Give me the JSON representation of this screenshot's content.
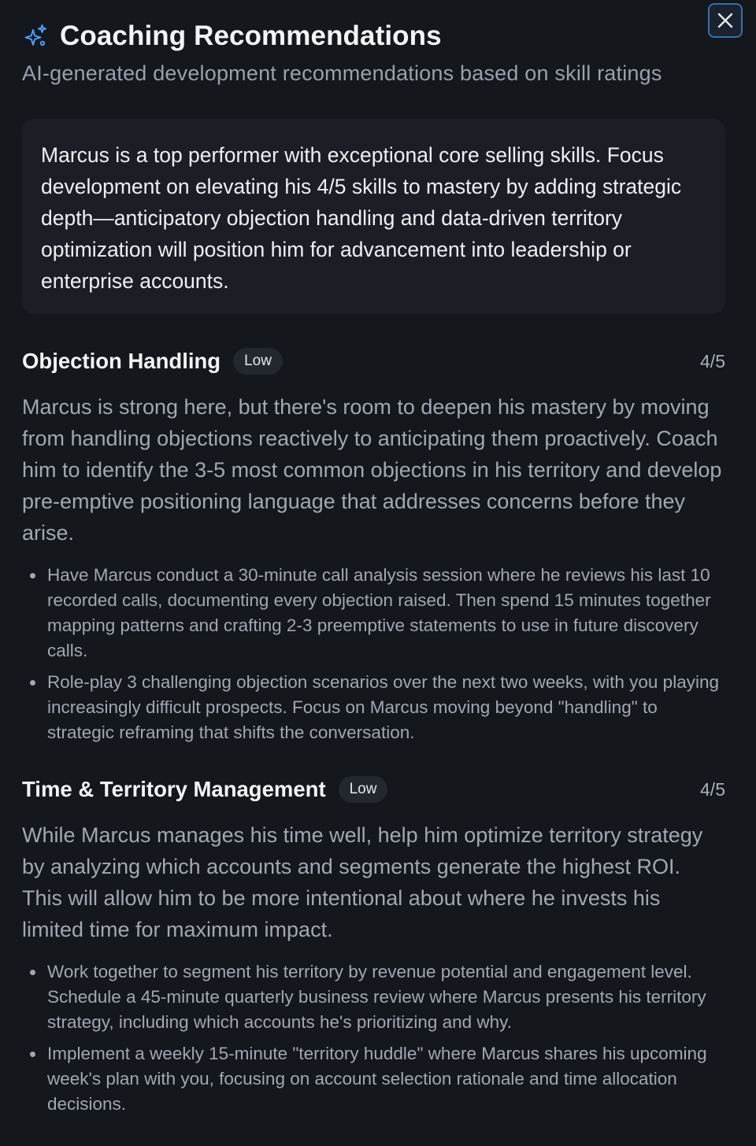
{
  "header": {
    "title": "Coaching Recommendations",
    "subtitle": "AI-generated development recommendations based on skill ratings",
    "icon": "sparkles-icon",
    "icon_color": "#4a9eff"
  },
  "close_button": {
    "icon": "close-icon"
  },
  "summary": "Marcus is a top performer with exceptional core selling skills. Focus development on elevating his 4/5 skills to mastery by adding strategic depth—anticipatory objection handling and data-driven territory optimization will position him for advancement into leadership or enterprise accounts.",
  "sections": [
    {
      "title": "Objection Handling",
      "badge": "Low",
      "score": "4/5",
      "body": "Marcus is strong here, but there's room to deepen his mastery by moving from handling objections reactively to anticipating them proactively. Coach him to identify the 3-5 most common objections in his territory and develop pre-emptive positioning language that addresses concerns before they arise.",
      "actions": [
        "Have Marcus conduct a 30-minute call analysis session where he reviews his last 10 recorded calls, documenting every objection raised. Then spend 15 minutes together mapping patterns and crafting 2-3 preemptive statements to use in future discovery calls.",
        "Role-play 3 challenging objection scenarios over the next two weeks, with you playing increasingly difficult prospects. Focus on Marcus moving beyond \"handling\" to strategic reframing that shifts the conversation."
      ]
    },
    {
      "title": "Time & Territory Management",
      "badge": "Low",
      "score": "4/5",
      "body": "While Marcus manages his time well, help him optimize territory strategy by analyzing which accounts and segments generate the highest ROI. This will allow him to be more intentional about where he invests his limited time for maximum impact.",
      "actions": [
        "Work together to segment his territory by revenue potential and engagement level. Schedule a 45-minute quarterly business review where Marcus presents his territory strategy, including which accounts he's prioritizing and why.",
        "Implement a weekly 15-minute \"territory huddle\" where Marcus shares his upcoming week's plan with you, focusing on account selection rationale and time allocation decisions."
      ]
    }
  ]
}
